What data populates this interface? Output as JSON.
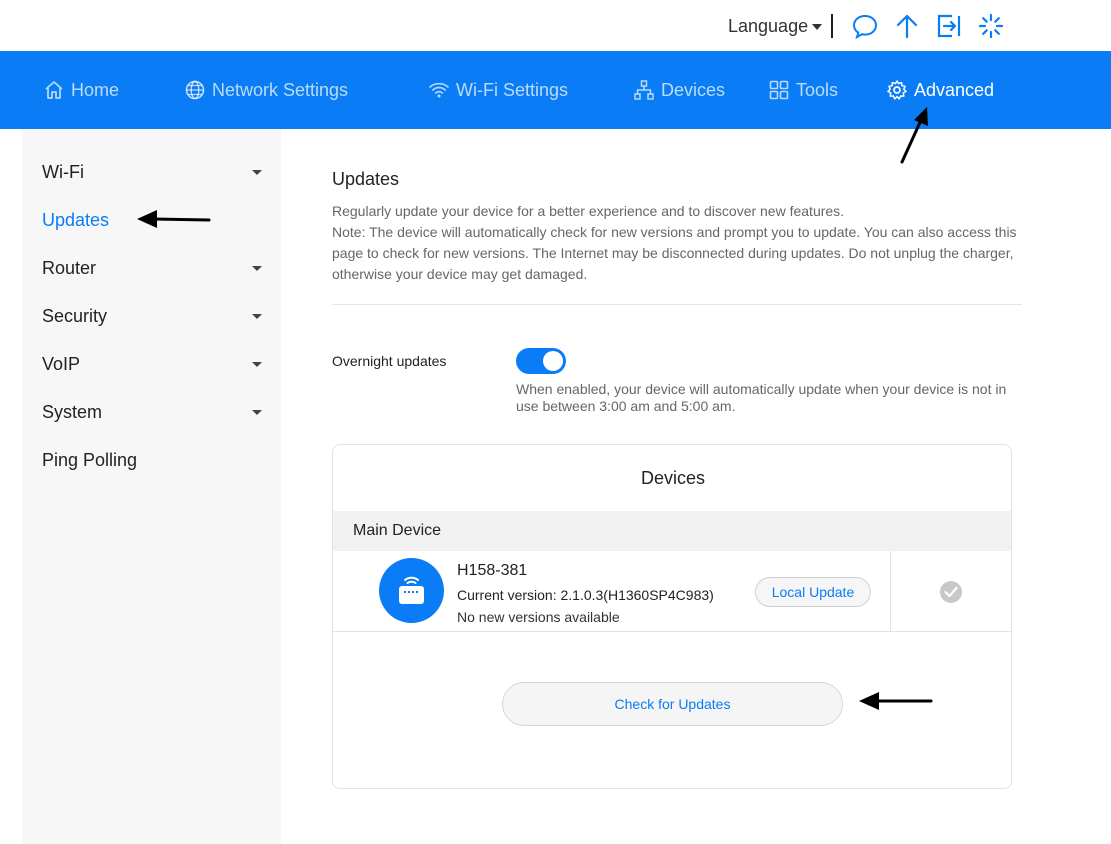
{
  "topbar": {
    "language_label": "Language",
    "icons": [
      "chat-icon",
      "upload-arrow-icon",
      "logout-icon",
      "loading-spinner-icon"
    ]
  },
  "nav": {
    "items": [
      {
        "label": "Home",
        "icon": "home-icon"
      },
      {
        "label": "Network Settings",
        "icon": "globe-icon"
      },
      {
        "label": "Wi-Fi Settings",
        "icon": "wifi-icon"
      },
      {
        "label": "Devices",
        "icon": "topology-icon"
      },
      {
        "label": "Tools",
        "icon": "grid-icon"
      },
      {
        "label": "Advanced",
        "icon": "gear-icon",
        "active": true
      }
    ]
  },
  "sidebar": {
    "items": [
      {
        "label": "Wi-Fi",
        "expandable": true
      },
      {
        "label": "Updates",
        "active": true
      },
      {
        "label": "Router",
        "expandable": true
      },
      {
        "label": "Security",
        "expandable": true
      },
      {
        "label": "VoIP",
        "expandable": true
      },
      {
        "label": "System",
        "expandable": true
      },
      {
        "label": "Ping Polling"
      }
    ]
  },
  "main": {
    "title": "Updates",
    "description": "Regularly update your device for a better experience and to discover new features.",
    "note": "Note: The device will automatically check for new versions and prompt you to update. You can also access this page to check for new versions. The Internet may be disconnected during updates. Do not unplug the charger, otherwise your device may get damaged.",
    "overnight": {
      "label": "Overnight updates",
      "enabled": true,
      "hint": "When enabled, your device will automatically update when your device is not in use between 3:00 am and 5:00 am."
    },
    "devices_card": {
      "title": "Devices",
      "section_label": "Main Device",
      "device": {
        "name": "H158-381",
        "version": "Current version: 2.1.0.3(H1360SP4C983)",
        "status": "No new versions available",
        "local_update_label": "Local Update"
      },
      "check_updates_label": "Check for Updates"
    }
  },
  "colors": {
    "accent": "#0a7cf5",
    "sidebar_bg": "#f7f7f7"
  }
}
